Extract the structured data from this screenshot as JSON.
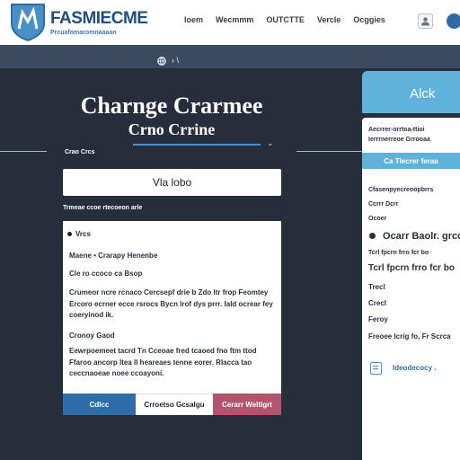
{
  "header": {
    "brand": "FASMIECME",
    "brand_sub": "Prcuafomaromnaaaan",
    "nav": [
      "Ioem",
      "Wecmmm",
      "OUTCTTE",
      "Vercle",
      "Ocggies"
    ],
    "icons": {
      "shield": "shield-logo-icon",
      "user": "user-icon",
      "dot": "circle-icon"
    }
  },
  "subbar": {
    "icon": "globe-icon",
    "chevron": "› \\"
  },
  "main": {
    "title": "Charnge Crarmee",
    "subtitle": "Crno Crrine",
    "small_note": "Crao Crcs",
    "search_value": "Vla lobo",
    "caption": "Trmeae ccoe rtecoeon arle",
    "card": {
      "heading": "Vrcs",
      "line1": "Maene • Crarapy Henenbe",
      "line2": "Cle ro ccoco ca Bsop",
      "para1": "Crumeor ncre rcnaco Cercsepf drie b Zdo ltr frop Feomtey Ercoro ecrner ecce rsrocs Bycn lrof dys prrr. Iald ocrear fey coeryinod ik.",
      "section": "Cronoy Gaod",
      "para2": "Eewrpoemeet tacrd Tn Cceoae fred tcaoed fno ftm ttod Ffaroo ancorp ltea ll heareaes tenne eorer. Rlacca tao ceccnaoeae noee ccoayoni."
    },
    "buttons": {
      "blue": "Cdlcc",
      "white": "Crroetso Gcsalgu",
      "pink": "Cerarr Weltlgrt"
    }
  },
  "right_panel": {
    "top_label": "Alck",
    "lines": [
      "Aecrrer-orrtoa-ttioi",
      "Ierrrnerreoe Grrooaa",
      "Cfasenpyecreoopbrrs"
    ],
    "button": "Ca Tlecrer feraa",
    "items": [
      "Ocoer",
      "Ccrrr     Dcrr",
      "Ocarr Baolr. grcor",
      "Tcrl fpcrn frro fcr bo",
      "Trecl",
      "Crecl",
      "Feroy",
      "Freoee  lcrig fo, Fr  Scrca"
    ],
    "link": "Ideodecocy .",
    "icons": {
      "note": "note-icon",
      "record": "record-icon"
    }
  },
  "colors": {
    "background": "#262d3b",
    "subbar": "#3a4a61",
    "accent_blue": "#2e6da9",
    "accent_light": "#5fb2d9",
    "accent_pink": "#b3536c"
  }
}
